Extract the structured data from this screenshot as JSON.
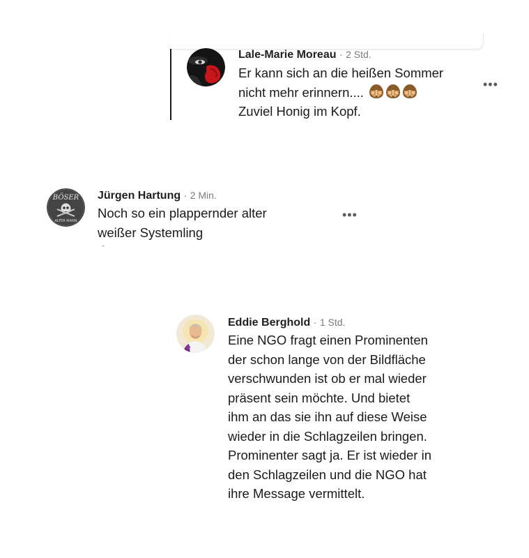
{
  "comments": [
    {
      "author": "Lale-Marie Moreau",
      "separator": "·",
      "time": "2 Std.",
      "lines": [
        "Er kann sich an die heißen Sommer",
        "nicht mehr erinnern....",
        "Zuviel Honig im Kopf."
      ],
      "emoji_count": 3,
      "more_label": "•••"
    },
    {
      "author": "Jürgen Hartung",
      "separator": "·",
      "time": "2 Min.",
      "lines": [
        "Noch so ein plappernder alter",
        "weißer Systemling"
      ],
      "avatar_text": [
        "BÖSER",
        "ALTER MANN"
      ],
      "more_label": "•••"
    },
    {
      "author": "Eddie Berghold",
      "separator": "·",
      "time": "1 Std.",
      "lines": [
        "Eine NGO fragt einen Prominenten",
        "der schon lange von der Bildfläche",
        "verschwunden ist ob er mal wieder",
        "präsent sein möchte. Und bietet",
        "ihm an das sie ihn auf diese Weise",
        "wieder in die Schlagzeilen bringen.",
        "Prominenter sagt ja. Er ist wieder in",
        "den Schlagzeilen und die NGO hat",
        "ihre Message vermittelt."
      ]
    }
  ]
}
